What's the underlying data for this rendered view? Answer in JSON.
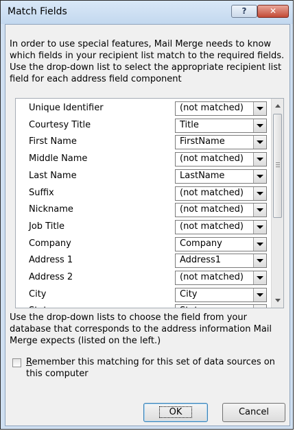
{
  "window": {
    "title": "Match Fields",
    "help_label": "?",
    "close_label": "✕"
  },
  "intro": "In order to use special features, Mail Merge needs to know which fields in your recipient list match to the required fields.  Use the drop-down list to select the appropriate recipient list field for each address field component",
  "fields": [
    {
      "label": "Unique Identifier",
      "value": "(not matched)"
    },
    {
      "label": "Courtesy Title",
      "value": "Title"
    },
    {
      "label": "First Name",
      "value": "FirstName"
    },
    {
      "label": "Middle Name",
      "value": "(not matched)"
    },
    {
      "label": "Last Name",
      "value": "LastName"
    },
    {
      "label": "Suffix",
      "value": "(not matched)"
    },
    {
      "label": "Nickname",
      "value": "(not matched)"
    },
    {
      "label": "Job Title",
      "value": "(not matched)"
    },
    {
      "label": "Company",
      "value": "Company"
    },
    {
      "label": "Address 1",
      "value": "Address1"
    },
    {
      "label": "Address 2",
      "value": "(not matched)"
    },
    {
      "label": "City",
      "value": "City"
    },
    {
      "label": "State",
      "value": "State"
    }
  ],
  "note": "Use the drop-down lists to choose the field from your database that corresponds to the address information Mail Merge expects (listed on the left.)",
  "remember": {
    "mnemonic": "R",
    "rest": "emember this matching for this set of data sources on this computer",
    "checked": false
  },
  "buttons": {
    "ok": "OK",
    "cancel": "Cancel"
  }
}
